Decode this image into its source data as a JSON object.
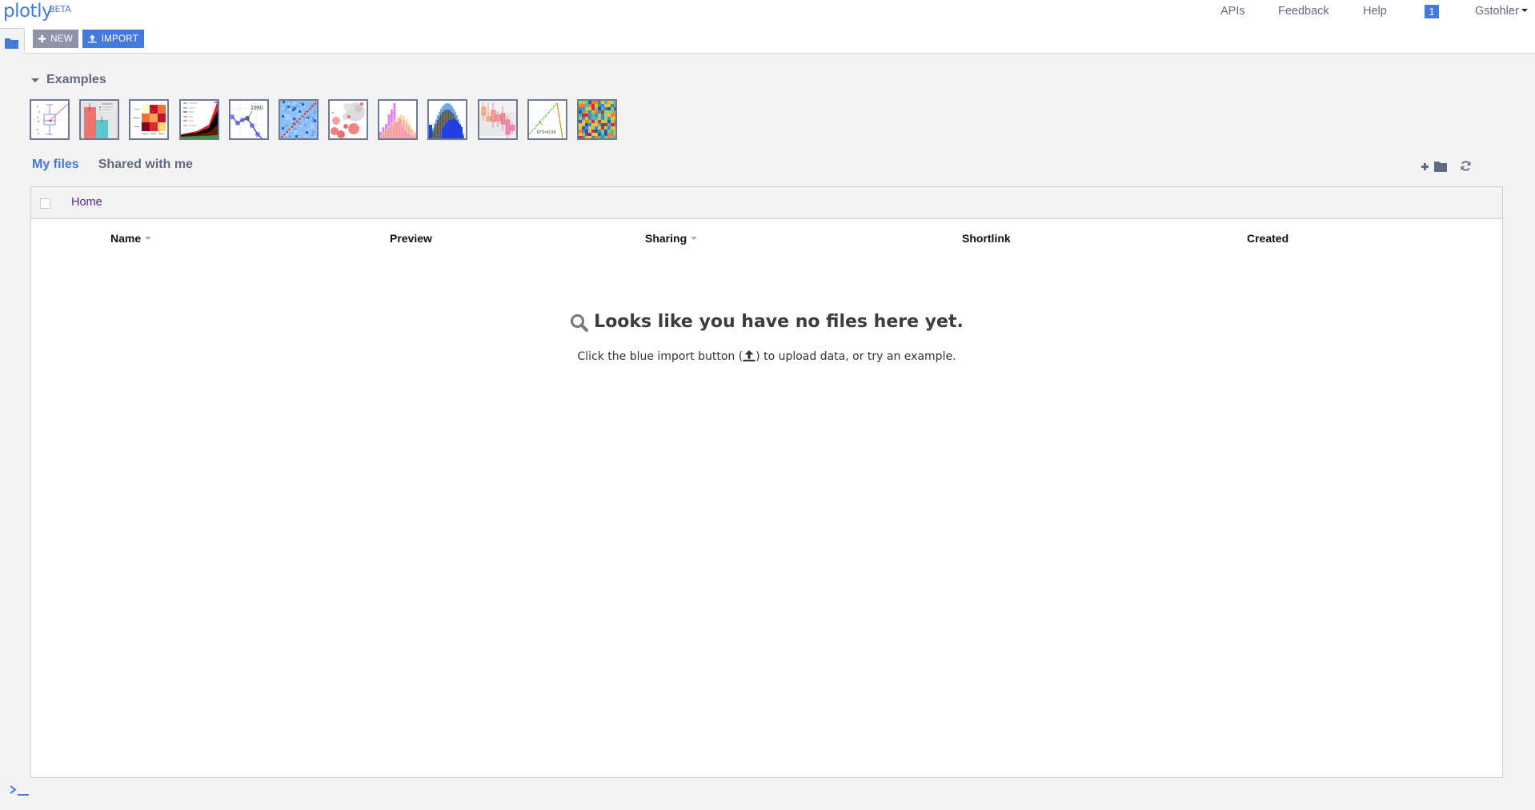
{
  "app": {
    "logo": "plotly",
    "logo_badge": "BETA",
    "brand_color": "#447adb"
  },
  "top_nav": {
    "links": [
      {
        "label": "APIs"
      },
      {
        "label": "Feedback"
      },
      {
        "label": "Help"
      }
    ],
    "notification_count": "1",
    "user_menu": "Gstohler"
  },
  "toolbar": {
    "folder_icon": "folder-icon",
    "new_label": "NEW",
    "new_icon": "plus-icon",
    "import_label": "IMPORT",
    "import_icon": "upload-icon"
  },
  "examples": {
    "title": "Examples",
    "expanded": true,
    "thumbnails": [
      {
        "name": "box-plot-example"
      },
      {
        "name": "bar-error-example",
        "legend_title": "Supplement",
        "legend_items": [
          "Orange Juice",
          "Vitamin C"
        ]
      },
      {
        "name": "heatmap-example",
        "y_labels": [
          "4pm",
          "12pm",
          "8am"
        ],
        "x_labels": [
          "Mon",
          "Tues",
          "Wed"
        ]
      },
      {
        "name": "stacked-area-example",
        "legend_items": [
          "Biomass",
          "Hydro",
          "Coal",
          "Oil",
          "Gas",
          "Nuclear"
        ]
      },
      {
        "name": "line-annotation-example",
        "annotation": "1990"
      },
      {
        "name": "scatter-matrix-example"
      },
      {
        "name": "bubble-chart-example"
      },
      {
        "name": "histogram-example"
      },
      {
        "name": "area-bars-example"
      },
      {
        "name": "candlestick-box-example"
      },
      {
        "name": "regression-example",
        "annotation": "R^2=0.99"
      },
      {
        "name": "color-grid-example"
      }
    ]
  },
  "file_tabs": {
    "tabs": [
      {
        "label": "My files",
        "active": true
      },
      {
        "label": "Shared with me",
        "active": false
      }
    ],
    "actions": [
      {
        "icon": "new-folder-icon"
      },
      {
        "icon": "refresh-icon"
      }
    ]
  },
  "file_browser": {
    "breadcrumb": [
      "Home"
    ],
    "columns": [
      {
        "label": "Name",
        "sortable": true
      },
      {
        "label": "Preview",
        "sortable": false
      },
      {
        "label": "Sharing",
        "sortable": true
      },
      {
        "label": "Shortlink",
        "sortable": false
      },
      {
        "label": "Created",
        "sortable": false
      }
    ],
    "rows": [],
    "empty_title": "Looks like you have no files here yet.",
    "empty_hint_before": "Click the blue import button (",
    "empty_hint_after": ") to upload data, or try an example."
  },
  "console": {
    "icon": "terminal-icon"
  }
}
